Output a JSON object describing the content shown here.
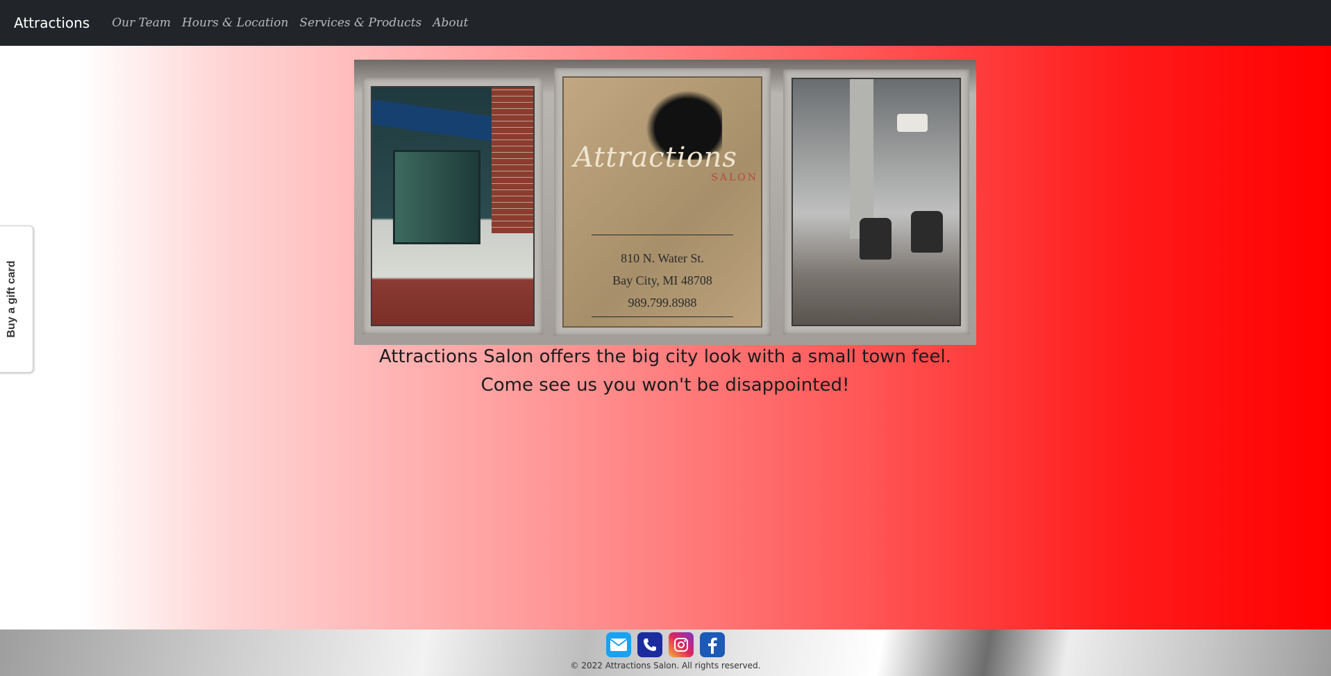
{
  "navbar": {
    "brand": "Attractions",
    "items": [
      {
        "label": "Our Team"
      },
      {
        "label": "Hours & Location"
      },
      {
        "label": "Services & Products"
      },
      {
        "label": "About"
      }
    ]
  },
  "gift_tab": {
    "label": "Buy a gift card"
  },
  "hero": {
    "card": {
      "logo_script": "Attractions",
      "logo_salon": "SALON",
      "address_line1": "810 N. Water St.",
      "address_line2": "Bay City, MI 48708",
      "phone": "989.799.8988"
    }
  },
  "tagline": {
    "line1": "Attractions Salon offers the big city look with a small town feel.",
    "line2": "Come see us you won't be disappointed!"
  },
  "footer": {
    "icons": [
      "email-icon",
      "phone-icon",
      "instagram-icon",
      "facebook-icon"
    ],
    "copyright": "© 2022 Attractions Salon. All rights reserved."
  }
}
